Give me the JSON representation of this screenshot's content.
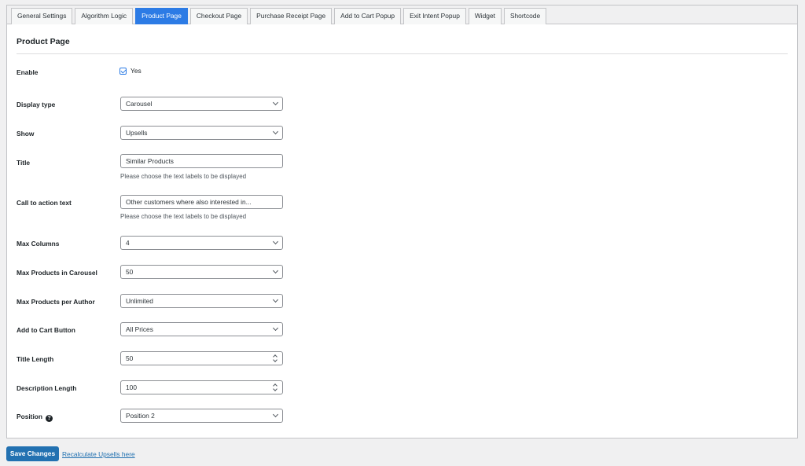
{
  "tabs": [
    {
      "label": "General Settings",
      "active": false
    },
    {
      "label": "Algorithm Logic",
      "active": false
    },
    {
      "label": "Product Page",
      "active": true
    },
    {
      "label": "Checkout Page",
      "active": false
    },
    {
      "label": "Purchase Receipt Page",
      "active": false
    },
    {
      "label": "Add to Cart Popup",
      "active": false
    },
    {
      "label": "Exit Intent Popup",
      "active": false
    },
    {
      "label": "Widget",
      "active": false
    },
    {
      "label": "Shortcode",
      "active": false
    }
  ],
  "section_title": "Product Page",
  "form": {
    "enable": {
      "label": "Enable",
      "checkbox_label": "Yes",
      "checked": true
    },
    "display_type": {
      "label": "Display type",
      "value": "Carousel"
    },
    "show": {
      "label": "Show",
      "value": "Upsells"
    },
    "title": {
      "label": "Title",
      "value": "Similar Products",
      "description": "Please choose the text labels to be displayed"
    },
    "cta_text": {
      "label": "Call to action text",
      "value": "Other customers where also interested in...",
      "description": "Please choose the text labels to be displayed"
    },
    "max_columns": {
      "label": "Max Columns",
      "value": "4"
    },
    "max_products_carousel": {
      "label": "Max Products in Carousel",
      "value": "50"
    },
    "max_products_author": {
      "label": "Max Products per Author",
      "value": "Unlimited"
    },
    "add_to_cart_button": {
      "label": "Add to Cart Button",
      "value": "All Prices"
    },
    "title_length": {
      "label": "Title Length",
      "value": "50"
    },
    "description_length": {
      "label": "Description Length",
      "value": "100"
    },
    "position": {
      "label": "Position",
      "value": "Position 2",
      "help_icon": "question-circle-icon"
    }
  },
  "footer": {
    "save_label": "Save Changes",
    "recalc_label": "Recalculate Upsells here"
  },
  "colors": {
    "accent": "#2c7be5",
    "primary_button": "#2271b1",
    "background": "#f0f0f1"
  }
}
